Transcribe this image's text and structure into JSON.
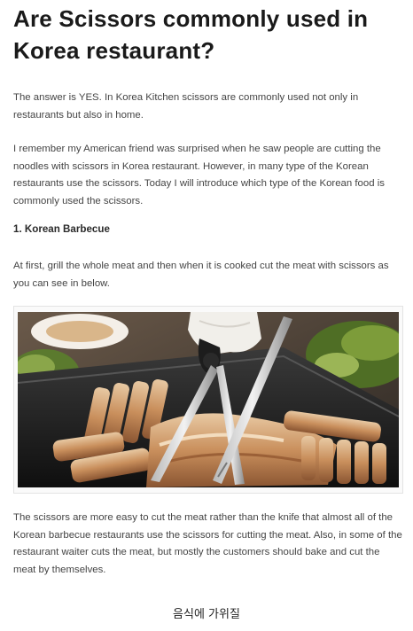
{
  "article": {
    "title": "Are Scissors commonly used in Korea restaurant?",
    "paragraphs": [
      "The answer is YES. In Korea Kitchen scissors are commonly used not only in restaurants but also in home.",
      "I remember my American friend was surprised when he saw people are cutting the noodles with scissors in Korea restaurant. However, in many type of the Korean restaurants use the scissors. Today I will introduce which type of the Korean food is commonly used the scissors.",
      "At first, grill the whole meat and then when it is cooked cut the meat with scissors as you can see in below.",
      "The scissors are more easy to cut the meat rather than the knife that almost all of the Korean barbecue restaurants use the scissors for cutting the meat. Also, in some of the restaurant waiter cuts the meat, but mostly the customers should bake and cut the meat by themselves."
    ],
    "subheading": "1. Korean Barbecue",
    "caption": "음식에 가위질"
  }
}
